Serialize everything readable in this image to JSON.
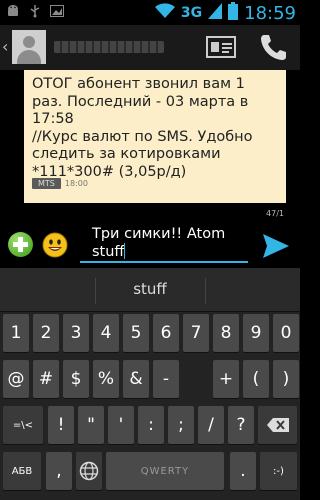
{
  "status_bar": {
    "network_label": "3G",
    "time": "18:59",
    "icons": [
      "android-icon",
      "usb-icon",
      "image-icon",
      "wifi-icon",
      "signal-icon",
      "battery-icon"
    ]
  },
  "action_bar": {
    "icons": [
      "contact-avatar",
      "contact-card-icon",
      "phone-icon"
    ]
  },
  "message": {
    "text": "ОТОГ абонент звонил вам 1\nраз. Последний -  03 марта в\n17:58\n//Курс валют по SMS. Удобно\nследить за котировками\n*111*300# (3,05р/д)",
    "sim": "MTS",
    "time": "18:00"
  },
  "compose": {
    "counter": "47/1",
    "text": "Три симки!! Atom\nstuff"
  },
  "keyboard": {
    "suggestion": "stuff",
    "rows": [
      [
        "1",
        "2",
        "3",
        "4",
        "5",
        "6",
        "7",
        "8",
        "9",
        "0"
      ],
      [
        "@",
        "#",
        "$",
        "%",
        "&",
        "-",
        "+",
        "(",
        ")"
      ],
      [
        "=\\<",
        "!",
        "\"",
        "'",
        ":",
        ";",
        "/",
        "?",
        "⌫"
      ],
      [
        "АБВ",
        ",",
        "",
        "QWERTY",
        ".",
        ":-)"
      ]
    ]
  },
  "colors": {
    "accent": "#33b5e5",
    "bubble": "#fbeec8",
    "key": "#4a4a4a"
  }
}
